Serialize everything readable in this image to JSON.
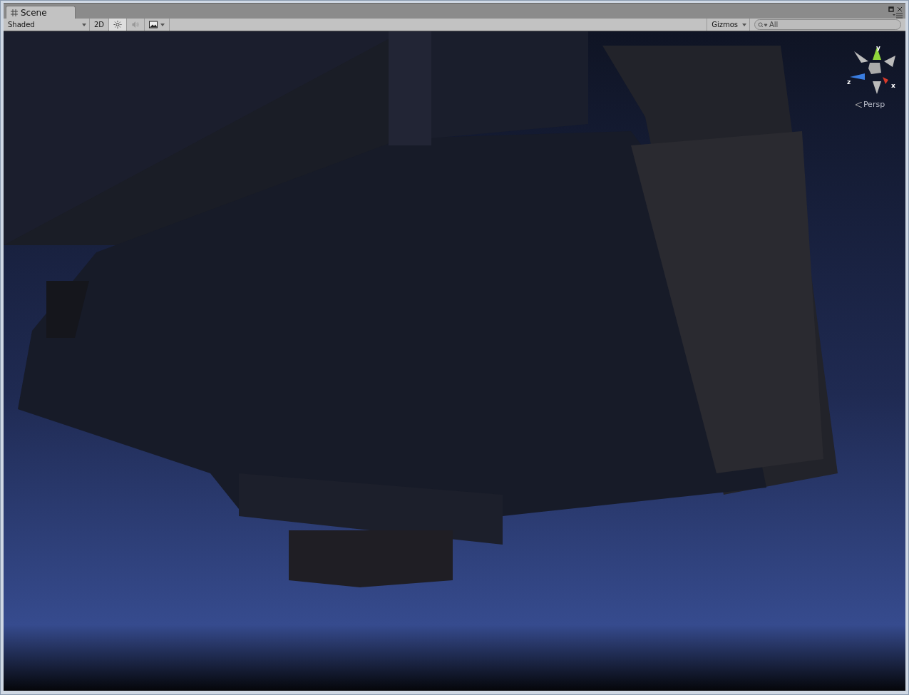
{
  "tab": {
    "title": "Scene",
    "selected": true
  },
  "toolbar": {
    "draw_mode": "Shaded",
    "toggles": [
      {
        "kind": "dimension",
        "label": "2D",
        "selected": false
      },
      {
        "kind": "lighting",
        "selected": true
      },
      {
        "kind": "audio",
        "selected": false
      },
      {
        "kind": "effects",
        "selected": false
      }
    ],
    "gizmos": "Gizmos",
    "search": {
      "placeholder": "All"
    }
  },
  "gizmo": {
    "axes": [
      {
        "label": "y",
        "color": "#8fd63a"
      },
      {
        "label": "z",
        "color": "#3a7de0"
      },
      {
        "label": "x",
        "color": "#d83a2a"
      }
    ],
    "projection": "Persp"
  }
}
